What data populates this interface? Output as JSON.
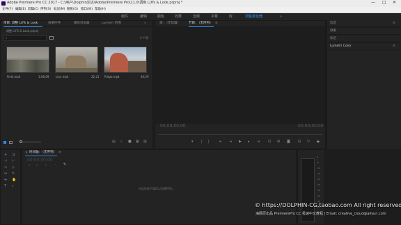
{
  "window": {
    "title": "Adobe Premiere Pro CC 2017 - C:\\用户\\Dolphin达达\\Adobe\\Premiere Pro\\11.0\\调色 LUTs & Look.prproj *",
    "minimize": "—",
    "maximize": "□",
    "close": "✕"
  },
  "menu": [
    "文件(F)",
    "编辑(E)",
    "剪辑(C)",
    "序列(S)",
    "标记(M)",
    "图形(G)",
    "窗口(W)",
    "帮助(H)"
  ],
  "workspaces": {
    "items": [
      "组件",
      "编辑",
      "颜色",
      "效果",
      "音频",
      "字幕",
      "库"
    ],
    "active": "调整着色器",
    "more": "»"
  },
  "project_panel": {
    "tabs": [
      "项目: 调整 LUTs & Look",
      "效果控件",
      "媒体浏览器",
      "Lumetri 范围"
    ],
    "more": "»",
    "path": "调整 LUTs & Look.prproj",
    "search_icon": "⌕",
    "item_count": "3 个项",
    "clips": [
      {
        "name": "Field.mp4",
        "duration": "1;06;09"
      },
      {
        "name": "Lion.mp4",
        "duration": "22;21"
      },
      {
        "name": "Ridge.mp4",
        "duration": "40;29"
      }
    ]
  },
  "source_monitor": {
    "tabs": [
      "源: （无剪辑）",
      "节目: （无序列）"
    ],
    "menu_icon": "≡",
    "timecode_left": "00;00;00;00",
    "timecode_right": "00;00;00;00"
  },
  "right_panels": [
    {
      "label": "信息",
      "icon": "≡"
    },
    {
      "label": "效果",
      "icon": ""
    },
    {
      "label": "标记",
      "icon": ""
    },
    {
      "label": "Lumetri Color",
      "icon": "≡"
    }
  ],
  "timeline": {
    "title": "时间轴: （无序列）",
    "menu_icon": "≡",
    "timecode": "00;00;00;00",
    "empty_message": "在此处放下媒体以创建序列。"
  },
  "audio_meter": {
    "scale": [
      "0",
      "-6",
      "-12",
      "-18",
      "-24",
      "-30",
      "-36",
      "-42",
      "-48",
      "-54",
      "dB"
    ]
  },
  "watermark": {
    "url": "© https://DOLPHIN-CG.taobao.com  All right reserved",
    "credit": "海豚原出品 PremierePro CC 极速中文教程 | Email: creative_cloud@aliyun.com"
  }
}
